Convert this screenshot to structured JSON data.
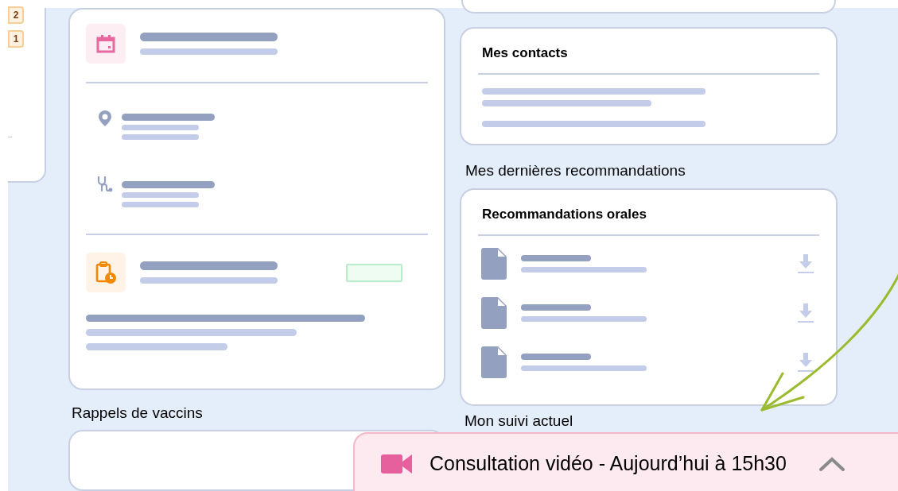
{
  "side_badges": [
    "2",
    "1"
  ],
  "contacts_card": {
    "title": "Mes contacts"
  },
  "recommendations": {
    "heading": "Mes dernières recommandations",
    "card_title": "Recommandations orales"
  },
  "vaccines": {
    "heading": "Rappels de vaccins"
  },
  "follow_up": {
    "heading": "Mon suivi actuel"
  },
  "banner": {
    "text": "Consultation vidéo - Aujourd’hui à 15h30",
    "expanded": false
  }
}
